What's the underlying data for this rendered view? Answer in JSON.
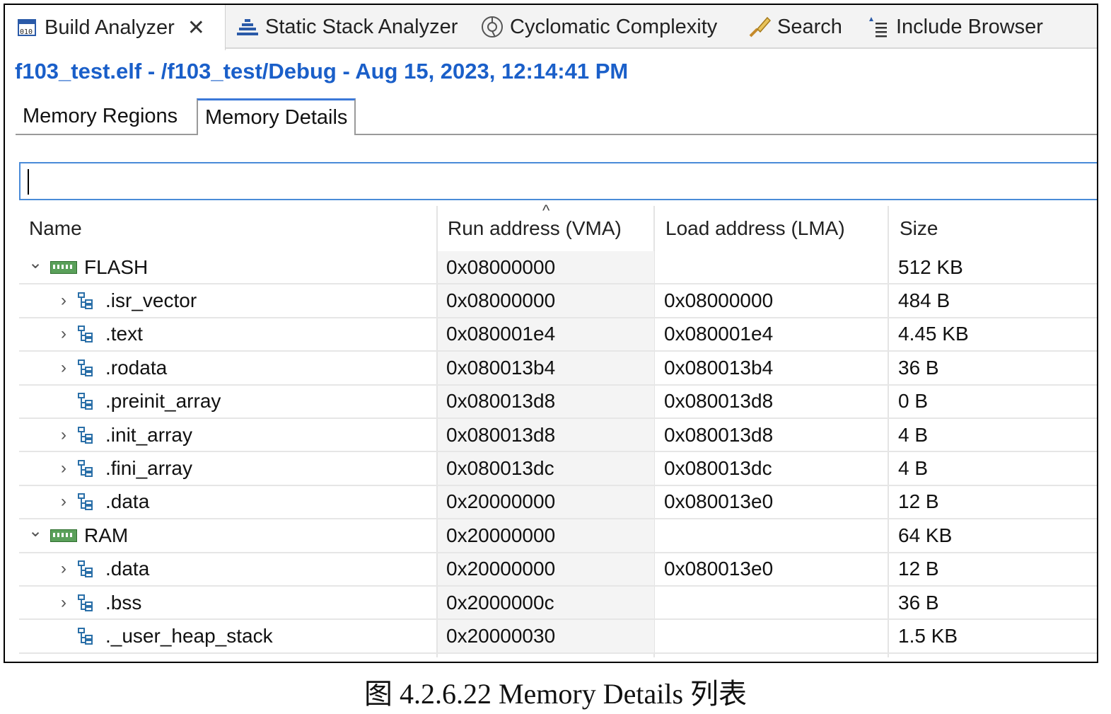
{
  "view_tabs": [
    {
      "label": "Build Analyzer",
      "icon": "build-analyzer-icon",
      "active": true
    },
    {
      "label": "Static Stack Analyzer",
      "icon": "stack-analyzer-icon"
    },
    {
      "label": "Cyclomatic Complexity",
      "icon": "cyclomatic-icon"
    },
    {
      "label": "Search",
      "icon": "search-icon"
    },
    {
      "label": "Include Browser",
      "icon": "include-browser-icon"
    }
  ],
  "file_title": "f103_test.elf - /f103_test/Debug - Aug 15, 2023, 12:14:41 PM",
  "sub_tabs": [
    "Memory Regions",
    "Memory Details"
  ],
  "filter": {
    "value": ""
  },
  "columns": [
    "Name",
    "Run address (VMA)",
    "Load address (LMA)",
    "Size"
  ],
  "rows": [
    {
      "name": "FLASH",
      "vma": "0x08000000",
      "lma": "",
      "size": "512 KB",
      "level": 0,
      "twisty": "expanded"
    },
    {
      "name": ".isr_vector",
      "vma": "0x08000000",
      "lma": "0x08000000",
      "size": "484 B",
      "level": 1,
      "twisty": "collapsed"
    },
    {
      "name": ".text",
      "vma": "0x080001e4",
      "lma": "0x080001e4",
      "size": "4.45 KB",
      "level": 1,
      "twisty": "collapsed"
    },
    {
      "name": ".rodata",
      "vma": "0x080013b4",
      "lma": "0x080013b4",
      "size": "36 B",
      "level": 1,
      "twisty": "collapsed"
    },
    {
      "name": ".preinit_array",
      "vma": "0x080013d8",
      "lma": "0x080013d8",
      "size": "0 B",
      "level": 1,
      "twisty": "none"
    },
    {
      "name": ".init_array",
      "vma": "0x080013d8",
      "lma": "0x080013d8",
      "size": "4 B",
      "level": 1,
      "twisty": "collapsed"
    },
    {
      "name": ".fini_array",
      "vma": "0x080013dc",
      "lma": "0x080013dc",
      "size": "4 B",
      "level": 1,
      "twisty": "collapsed"
    },
    {
      "name": ".data",
      "vma": "0x20000000",
      "lma": "0x080013e0",
      "size": "12 B",
      "level": 1,
      "twisty": "collapsed"
    },
    {
      "name": "RAM",
      "vma": "0x20000000",
      "lma": "",
      "size": "64 KB",
      "level": 0,
      "twisty": "expanded"
    },
    {
      "name": ".data",
      "vma": "0x20000000",
      "lma": "0x080013e0",
      "size": "12 B",
      "level": 1,
      "twisty": "collapsed"
    },
    {
      "name": ".bss",
      "vma": "0x2000000c",
      "lma": "",
      "size": "36 B",
      "level": 1,
      "twisty": "collapsed"
    },
    {
      "name": "._user_heap_stack",
      "vma": "0x20000030",
      "lma": "",
      "size": "1.5 KB",
      "level": 1,
      "twisty": "none"
    }
  ],
  "caption": "图 4.2.6.22 Memory Details 列表",
  "colors": {
    "title_blue": "#1a5fc9",
    "filter_border": "#4a8bd8",
    "memory_icon": "#5aa05a"
  }
}
